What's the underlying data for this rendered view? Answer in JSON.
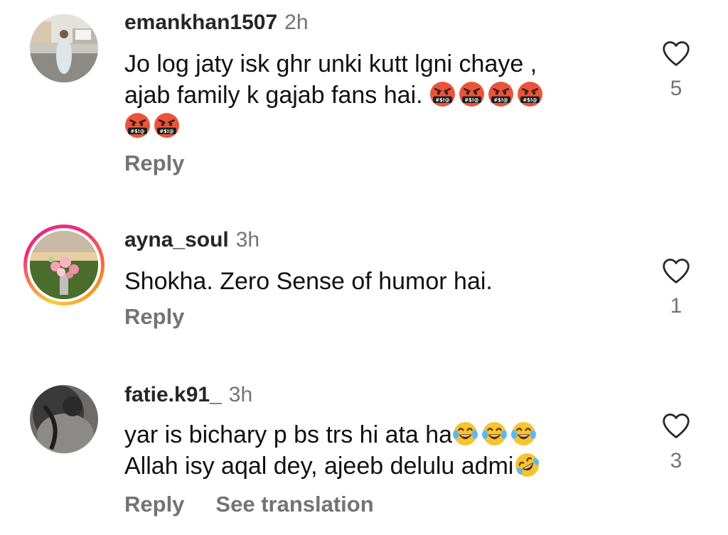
{
  "comments": [
    {
      "username": "emankhan1507",
      "time": "2h",
      "text_line1": "Jo log jaty isk ghr unki kutt lgni chaye ,",
      "text_line2": "ajab family k gajab fans hai.",
      "emoji_line2": [
        "face-with-symbols-on-mouth-icon",
        "face-with-symbols-on-mouth-icon",
        "face-with-symbols-on-mouth-icon",
        "face-with-symbols-on-mouth-icon"
      ],
      "emoji_line3": [
        "face-with-symbols-on-mouth-icon",
        "face-with-symbols-on-mouth-icon"
      ],
      "emoji_symbol_text": "#$!@",
      "reply_label": "Reply",
      "likes": "5"
    },
    {
      "username": "ayna_soul",
      "time": "3h",
      "text_line1": "Shokha. Zero Sense of humor hai.",
      "reply_label": "Reply",
      "likes": "1",
      "has_story_ring": true
    },
    {
      "username": "fatie.k91_",
      "time": "3h",
      "text_line1": "yar is bichary p bs trs hi ata ha",
      "emoji_line1": [
        "face-with-tears-of-joy-icon",
        "face-with-tears-of-joy-icon",
        "face-with-tears-of-joy-icon"
      ],
      "text_line2": "Allah isy aqal dey, ajeeb delulu admi",
      "emoji_line2": [
        "rolling-on-floor-laughing-icon"
      ],
      "reply_label": "Reply",
      "see_translation_label": "See translation",
      "likes": "3"
    }
  ],
  "colors": {
    "secondary_text": "#737373",
    "primary_text": "#262626",
    "heart_outline": "#262626"
  }
}
